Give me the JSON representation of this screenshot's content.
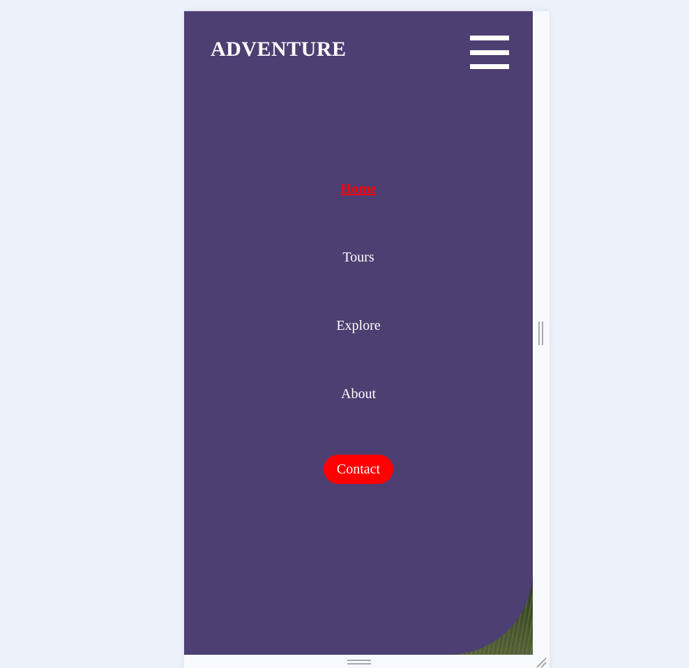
{
  "header": {
    "logo_text": "ADVENTURE",
    "menu_icon": "hamburger-menu-icon"
  },
  "nav": {
    "items": [
      {
        "label": "Home",
        "active": true
      },
      {
        "label": "Tours",
        "active": false
      },
      {
        "label": "Explore",
        "active": false
      },
      {
        "label": "About",
        "active": false
      }
    ],
    "contact_label": "Contact"
  },
  "colors": {
    "page_background": "#edf1f9",
    "menu_background": "#4e3f72",
    "accent": "#ff0000",
    "text": "#ffffff"
  }
}
